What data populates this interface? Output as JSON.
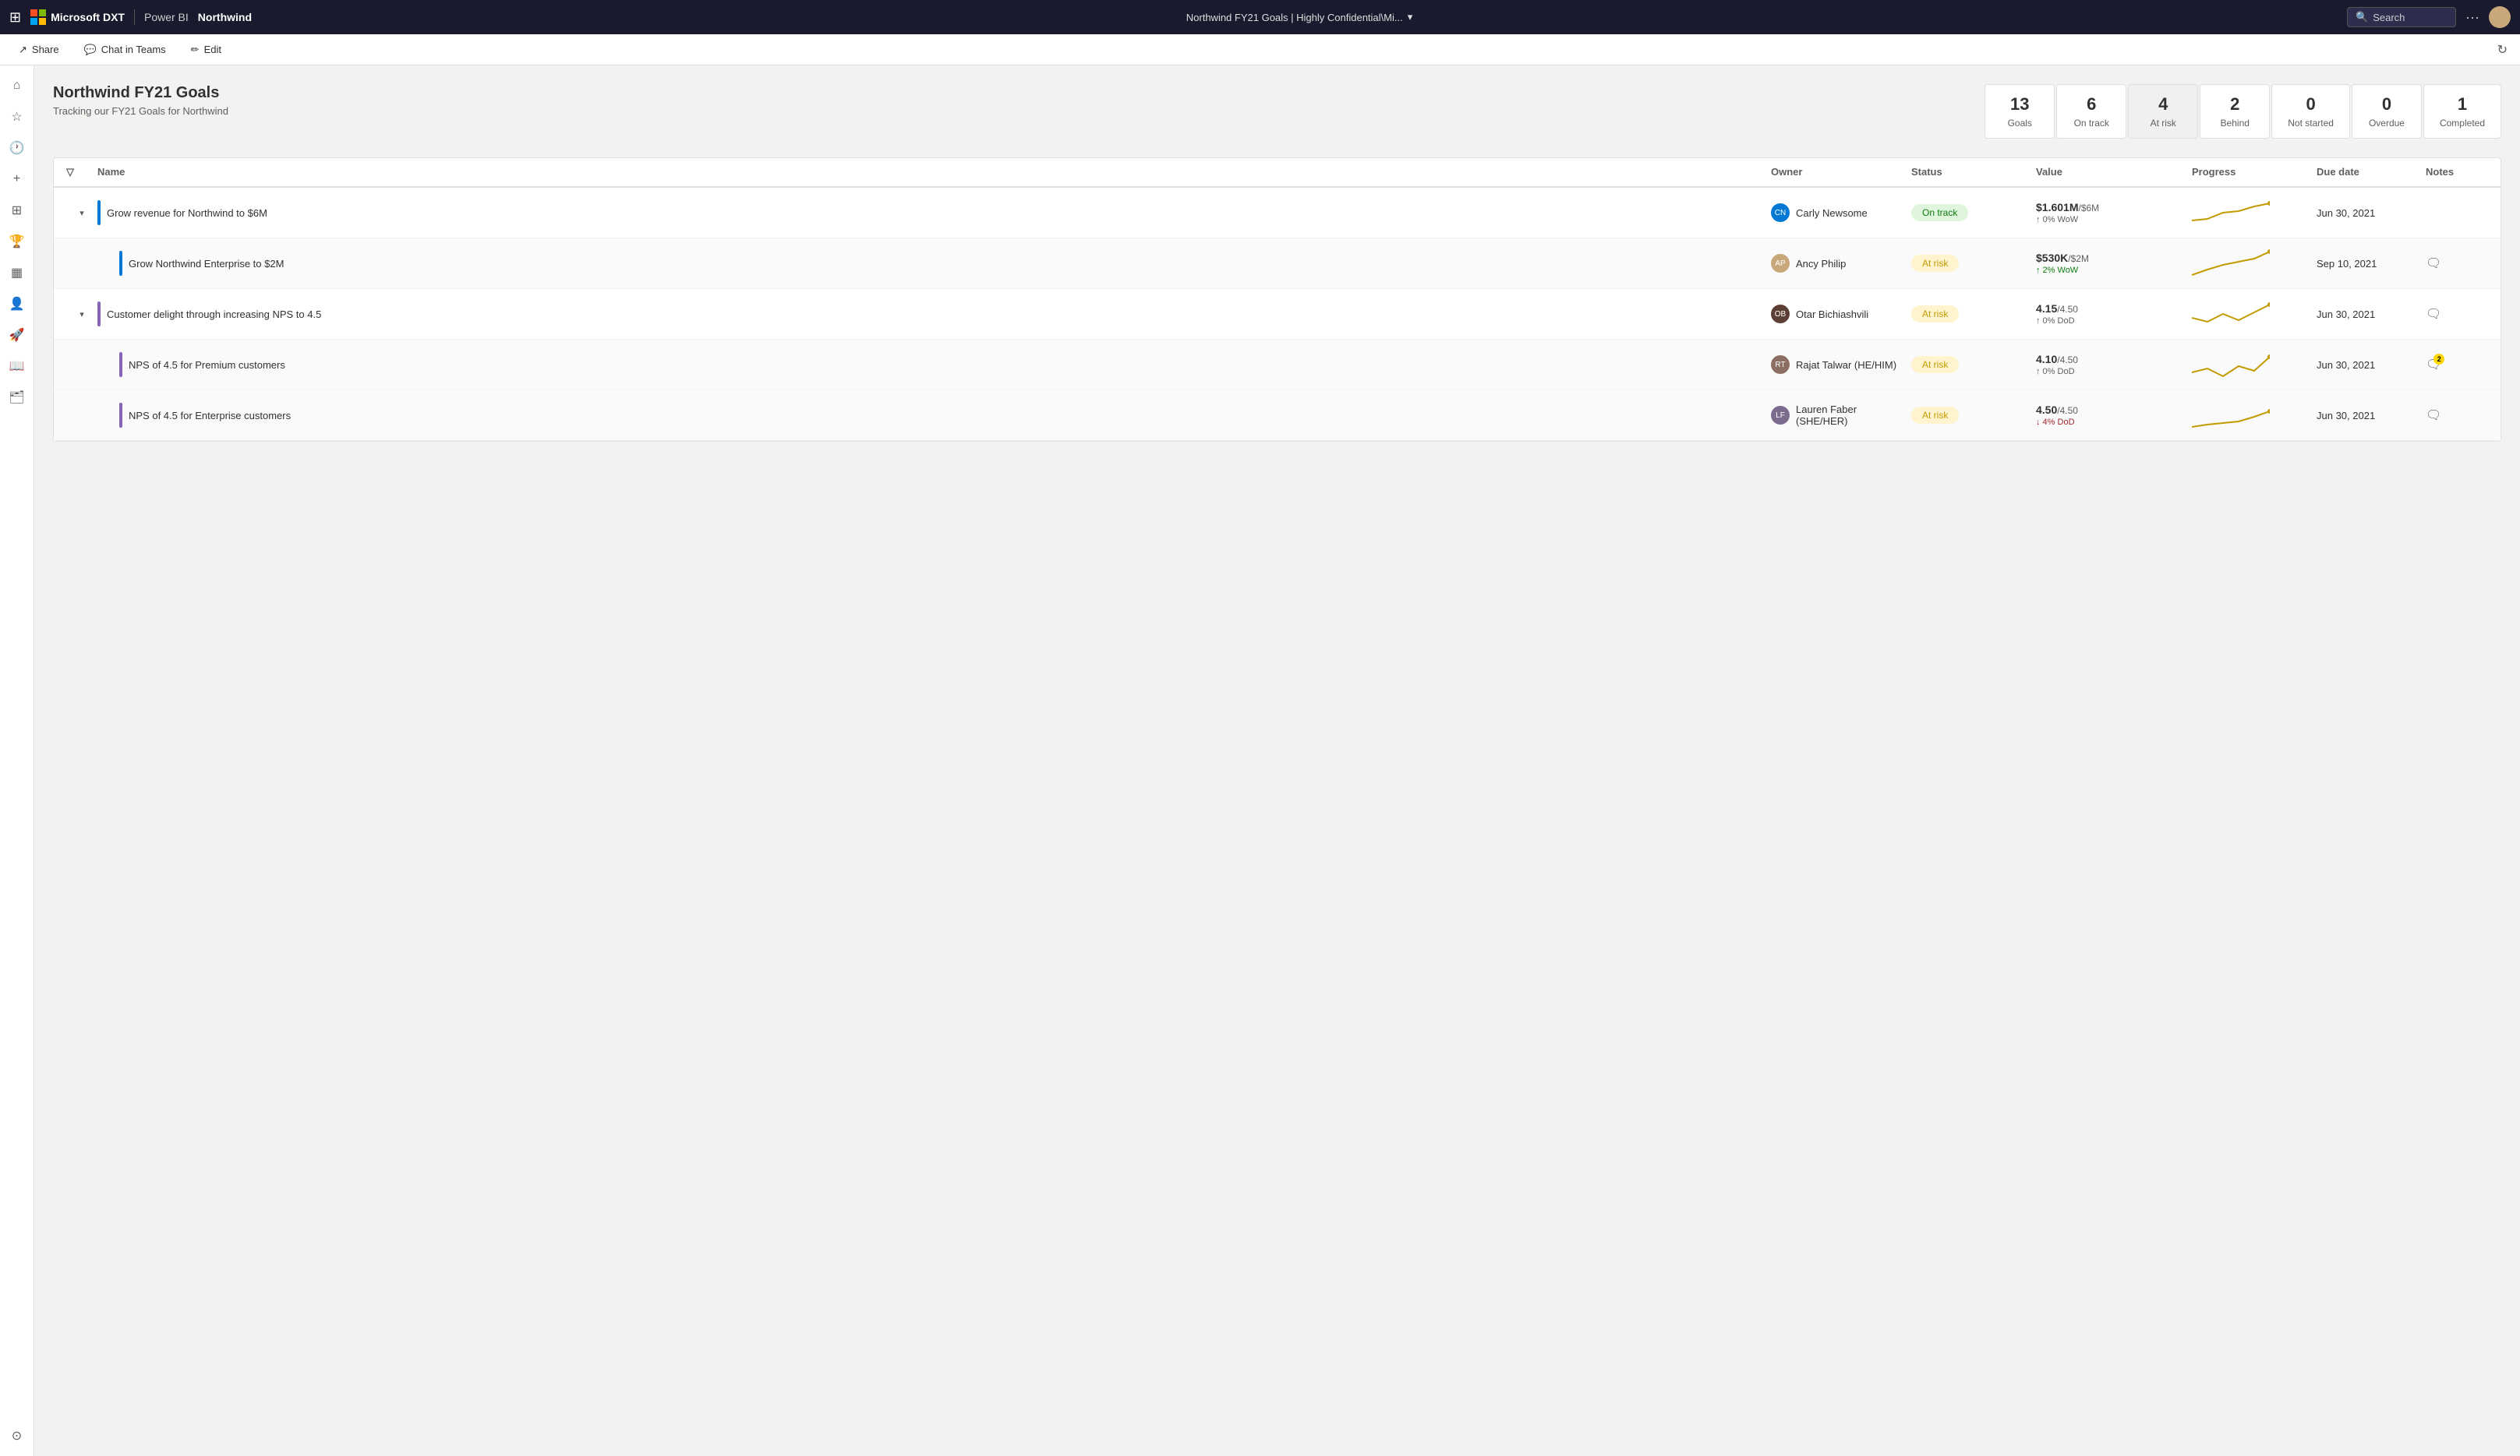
{
  "topnav": {
    "apps_icon": "⊞",
    "brand": "Microsoft DXT",
    "divider": "|",
    "powerbi": "Power BI",
    "report": "Northwind",
    "title": "Northwind FY21 Goals  |  Highly Confidential\\Mi...",
    "chevron": "▾",
    "search_placeholder": "Search",
    "more": "···"
  },
  "secnav": {
    "share_icon": "↗",
    "share_label": "Share",
    "teams_icon": "💬",
    "teams_label": "Chat in Teams",
    "edit_icon": "✏",
    "edit_label": "Edit",
    "refresh_icon": "↻"
  },
  "sidebar": {
    "icons": [
      {
        "name": "home-icon",
        "glyph": "⌂"
      },
      {
        "name": "favorites-icon",
        "glyph": "☆"
      },
      {
        "name": "recents-icon",
        "glyph": "🕐"
      },
      {
        "name": "create-icon",
        "glyph": "+"
      },
      {
        "name": "scorecard-icon",
        "glyph": "⊞"
      },
      {
        "name": "goals-icon",
        "glyph": "🏆"
      },
      {
        "name": "apps-icon",
        "glyph": "▦"
      },
      {
        "name": "people-icon",
        "glyph": "👤"
      },
      {
        "name": "deploy-icon",
        "glyph": "🚀"
      },
      {
        "name": "learn-icon",
        "glyph": "📖"
      },
      {
        "name": "workspaces-icon",
        "glyph": "🗂"
      },
      {
        "name": "profile-icon",
        "glyph": "⊙"
      }
    ]
  },
  "scorecard": {
    "title": "Northwind FY21 Goals",
    "subtitle": "Tracking our FY21 Goals for Northwind",
    "stats": [
      {
        "number": "13",
        "label": "Goals",
        "active": false
      },
      {
        "number": "6",
        "label": "On track",
        "active": false
      },
      {
        "number": "4",
        "label": "At risk",
        "active": true
      },
      {
        "number": "2",
        "label": "Behind",
        "active": false
      },
      {
        "number": "0",
        "label": "Not started",
        "active": false
      },
      {
        "number": "0",
        "label": "Overdue",
        "active": false
      },
      {
        "number": "1",
        "label": "Completed",
        "active": false
      }
    ]
  },
  "table": {
    "headers": [
      "",
      "Name",
      "Owner",
      "Status",
      "Value",
      "Progress",
      "Due date",
      "Notes"
    ],
    "filter_icon": "▽",
    "rows": [
      {
        "id": "row1",
        "level": 0,
        "expandable": true,
        "expanded": true,
        "color_bar": "blue",
        "name": "Grow revenue for Northwind to $6M",
        "owner_name": "Carly Newsome",
        "owner_initials": "CN",
        "owner_color": "avatar-cn",
        "status": "On track",
        "status_class": "status-on-track",
        "value_main": "$1.601M",
        "value_target": "/$6M",
        "value_change": "↑ 0% WoW",
        "value_change_class": "",
        "progress_pct": 27,
        "progress_class": "progress-green",
        "due_date": "Jun 30, 2021",
        "has_notes": false,
        "notes_count": 0
      },
      {
        "id": "row2",
        "level": 1,
        "expandable": false,
        "expanded": false,
        "color_bar": "blue",
        "name": "Grow Northwind Enterprise to $2M",
        "owner_name": "Ancy Philip",
        "owner_initials": "AP",
        "owner_color": "avatar-ap",
        "status": "At risk",
        "status_class": "status-at-risk",
        "value_main": "$530K",
        "value_target": "/$2M",
        "value_change": "↑ 2% WoW",
        "value_change_class": "up",
        "progress_pct": 26,
        "progress_class": "progress-yellow",
        "due_date": "Sep 10, 2021",
        "has_notes": true,
        "notes_count": 0
      },
      {
        "id": "row3",
        "level": 0,
        "expandable": true,
        "expanded": true,
        "color_bar": "purple",
        "name": "Customer delight through increasing NPS to 4.5",
        "owner_name": "Otar Bichiashvili",
        "owner_initials": "OB",
        "owner_color": "avatar-ob",
        "status": "At risk",
        "status_class": "status-at-risk",
        "value_main": "4.15",
        "value_target": "/4.50",
        "value_change": "↑ 0% DoD",
        "value_change_class": "",
        "progress_pct": 92,
        "progress_class": "progress-yellow",
        "due_date": "Jun 30, 2021",
        "has_notes": true,
        "notes_count": 0
      },
      {
        "id": "row4",
        "level": 1,
        "expandable": false,
        "expanded": false,
        "color_bar": "purple",
        "name": "NPS of 4.5 for Premium customers",
        "owner_name": "Rajat Talwar (HE/HIM)",
        "owner_initials": "RT",
        "owner_color": "avatar-rt",
        "status": "At risk",
        "status_class": "status-at-risk",
        "value_main": "4.10",
        "value_target": "/4.50",
        "value_change": "↑ 0% DoD",
        "value_change_class": "",
        "progress_pct": 91,
        "progress_class": "progress-yellow",
        "due_date": "Jun 30, 2021",
        "has_notes": true,
        "notes_count": 2
      },
      {
        "id": "row5",
        "level": 1,
        "expandable": false,
        "expanded": false,
        "color_bar": "purple",
        "name": "NPS of 4.5 for Enterprise customers",
        "owner_name": "Lauren Faber (SHE/HER)",
        "owner_initials": "LF",
        "owner_color": "avatar-lf",
        "status": "At risk",
        "status_class": "status-at-risk",
        "value_main": "4.50",
        "value_target": "/4.50",
        "value_change": "↓ 4% DoD",
        "value_change_class": "down",
        "progress_pct": 100,
        "progress_class": "progress-yellow",
        "due_date": "Jun 30, 2021",
        "has_notes": true,
        "notes_count": 0
      }
    ]
  }
}
